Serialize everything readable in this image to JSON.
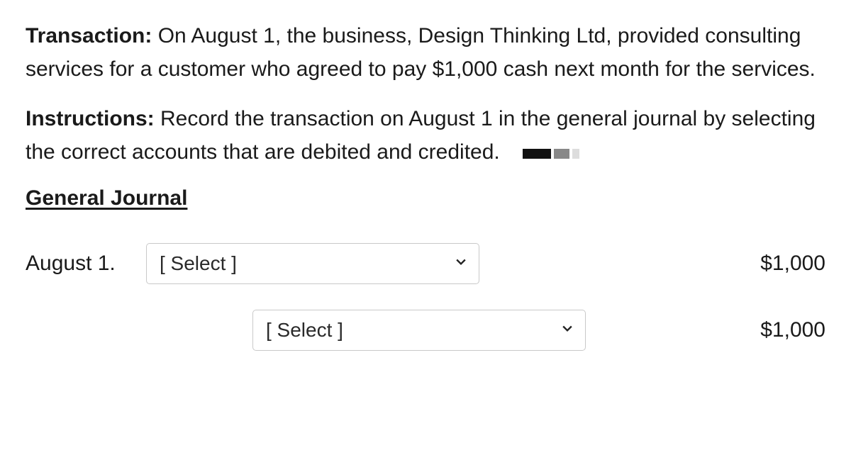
{
  "transaction": {
    "label": "Transaction:",
    "text": "On August 1, the business, Design Thinking Ltd, provided consulting services for a customer who agreed to pay $1,000 cash next month for the services."
  },
  "instructions": {
    "label": "Instructions:",
    "text": "Record the transaction on August 1 in the general journal by selecting the correct accounts that are debited and credited."
  },
  "journal": {
    "heading": "General Journal",
    "rows": [
      {
        "date": "August 1.",
        "select_text": "[ Select ]",
        "amount": "$1,000"
      },
      {
        "date": "",
        "select_text": "[ Select ]",
        "amount": "$1,000"
      }
    ]
  }
}
